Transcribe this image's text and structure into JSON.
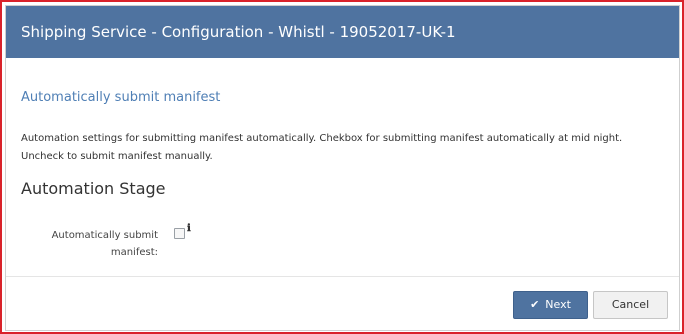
{
  "dialog": {
    "title": "Shipping Service - Configuration - Whistl - 19052017-UK-1"
  },
  "section": {
    "title": "Automatically submit manifest",
    "description": "Automation settings for submitting manifest automatically. Chekbox for submitting manifest automatically at mid night. Uncheck to submit manifest manually."
  },
  "stage": {
    "heading": "Automation Stage",
    "field_label": "Automatically submit manifest:",
    "checkbox_checked": false,
    "info_glyph": "ℹ"
  },
  "footer": {
    "next_label": "Next",
    "next_icon": "✔",
    "cancel_label": "Cancel"
  },
  "colors": {
    "titlebar": "#4f73a0",
    "section_title": "#4f7fb5",
    "highlight_border": "#d9222a"
  }
}
